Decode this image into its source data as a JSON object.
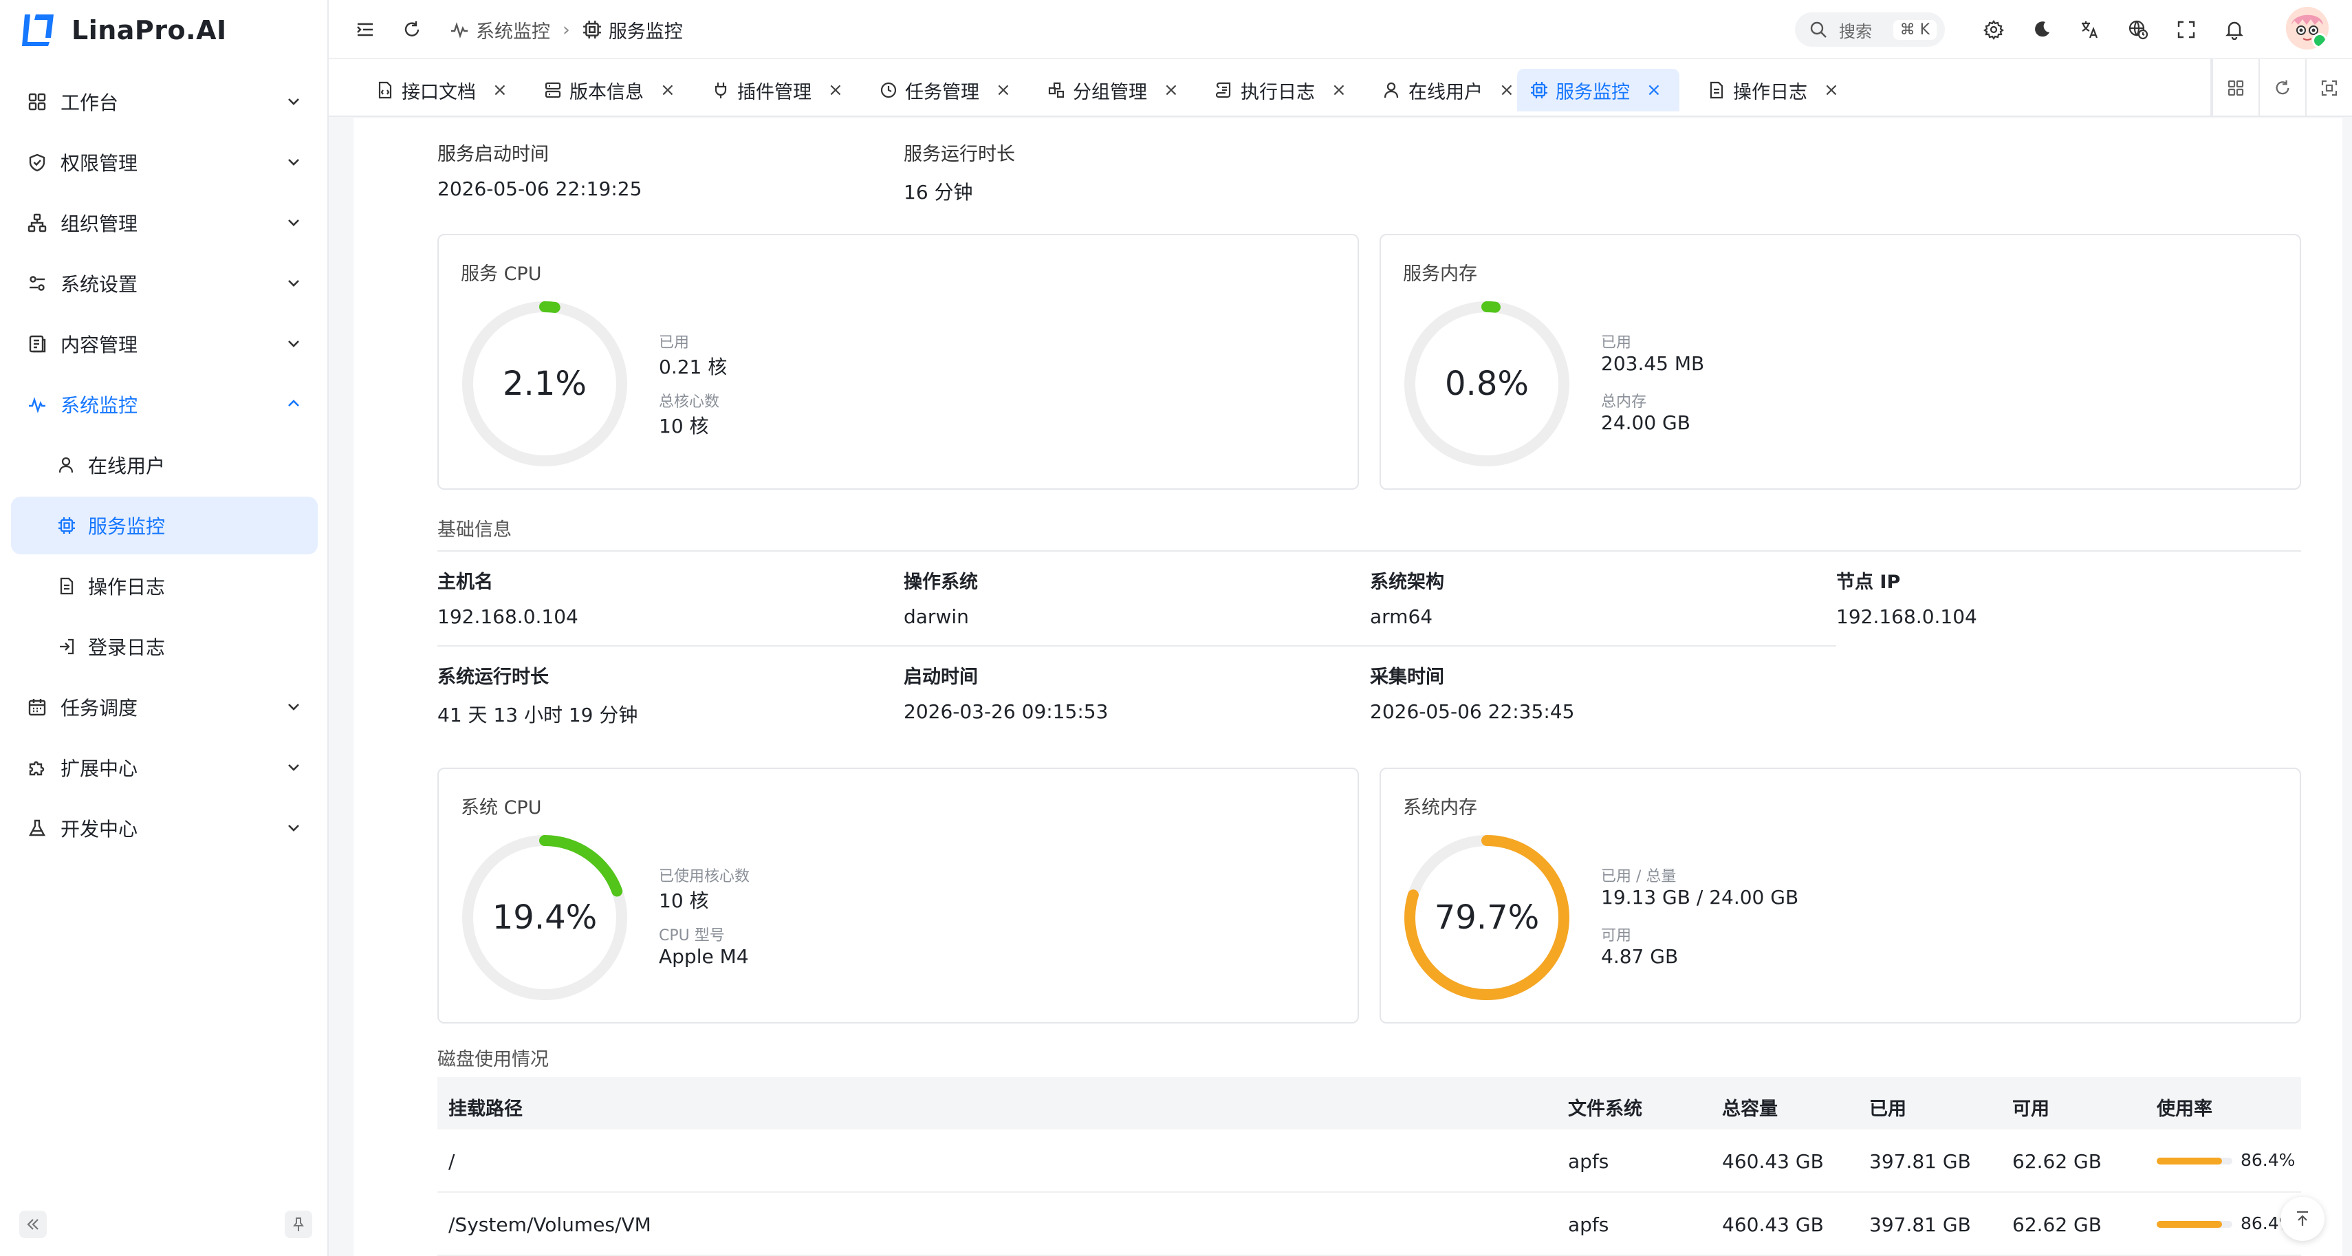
{
  "app": {
    "name": "LinaPro.AI"
  },
  "colors": {
    "accent": "#1677ff",
    "green": "#52c41a",
    "orange": "#f5a623",
    "track": "#ededed"
  },
  "sidebar": {
    "items": [
      {
        "label": "工作台",
        "icon": "dashboard-icon"
      },
      {
        "label": "权限管理",
        "icon": "shield-icon"
      },
      {
        "label": "组织管理",
        "icon": "org-tree-icon"
      },
      {
        "label": "系统设置",
        "icon": "settings-sliders-icon"
      },
      {
        "label": "内容管理",
        "icon": "document-icon"
      },
      {
        "label": "系统监控",
        "icon": "pulse-icon",
        "expanded": true
      }
    ],
    "subitems": [
      {
        "label": "在线用户",
        "icon": "user-icon"
      },
      {
        "label": "服务监控",
        "icon": "chip-icon",
        "active": true
      },
      {
        "label": "操作日志",
        "icon": "file-icon"
      },
      {
        "label": "登录日志",
        "icon": "login-icon"
      }
    ],
    "items_after": [
      {
        "label": "任务调度",
        "icon": "calendar-icon"
      },
      {
        "label": "扩展中心",
        "icon": "puzzle-icon"
      },
      {
        "label": "开发中心",
        "icon": "flask-icon"
      }
    ]
  },
  "header": {
    "breadcrumb": [
      "系统监控",
      "服务监控"
    ],
    "search_placeholder": "搜索",
    "search_shortcut": "⌘ K"
  },
  "tabs": [
    {
      "label": "接口文档",
      "icon": "doc-icon"
    },
    {
      "label": "版本信息",
      "icon": "server-icon"
    },
    {
      "label": "插件管理",
      "icon": "plug-icon"
    },
    {
      "label": "任务管理",
      "icon": "clock-icon"
    },
    {
      "label": "分组管理",
      "icon": "group-icon"
    },
    {
      "label": "执行日志",
      "icon": "scroll-icon"
    },
    {
      "label": "在线用户",
      "icon": "user-icon"
    },
    {
      "label": "服务监控",
      "icon": "chip-icon",
      "active": true
    },
    {
      "label": "操作日志",
      "icon": "file-icon"
    }
  ],
  "service": {
    "start_label": "服务启动时间",
    "start_value": "2026-05-06 22:19:25",
    "uptime_label": "服务运行时长",
    "uptime_value": "16 分钟"
  },
  "service_cpu": {
    "title": "服务 CPU",
    "percent_text": "2.1%",
    "percent": 2.1,
    "used_label": "已用",
    "used_value": "0.21 核",
    "total_label": "总核心数",
    "total_value": "10 核"
  },
  "service_mem": {
    "title": "服务内存",
    "percent_text": "0.8%",
    "percent": 0.8,
    "used_label": "已用",
    "used_value": "203.45 MB",
    "total_label": "总内存",
    "total_value": "24.00 GB"
  },
  "basic": {
    "title": "基础信息",
    "hostname_label": "主机名",
    "hostname_value": "192.168.0.104",
    "os_label": "操作系统",
    "os_value": "darwin",
    "arch_label": "系统架构",
    "arch_value": "arm64",
    "ip_label": "节点 IP",
    "ip_value": "192.168.0.104",
    "uptime_label": "系统运行时长",
    "uptime_value": "41 天 13 小时 19 分钟",
    "boot_label": "启动时间",
    "boot_value": "2026-03-26 09:15:53",
    "collect_label": "采集时间",
    "collect_value": "2026-05-06 22:35:45"
  },
  "sys_cpu": {
    "title": "系统 CPU",
    "percent_text": "19.4%",
    "percent": 19.4,
    "cores_label": "已使用核心数",
    "cores_value": "10 核",
    "model_label": "CPU 型号",
    "model_value": "Apple M4"
  },
  "sys_mem": {
    "title": "系统内存",
    "percent_text": "79.7%",
    "percent": 79.7,
    "used_label": "已用 / 总量",
    "used_value": "19.13 GB / 24.00 GB",
    "avail_label": "可用",
    "avail_value": "4.87 GB"
  },
  "disk": {
    "title": "磁盘使用情况",
    "columns": [
      "挂载路径",
      "文件系统",
      "总容量",
      "已用",
      "可用",
      "使用率"
    ],
    "rows": [
      {
        "path": "/",
        "fs": "apfs",
        "total": "460.43 GB",
        "used": "397.81 GB",
        "free": "62.62 GB",
        "rate_text": "86.4%",
        "rate": 86.4
      },
      {
        "path": "/System/Volumes/VM",
        "fs": "apfs",
        "total": "460.43 GB",
        "used": "397.81 GB",
        "free": "62.62 GB",
        "rate_text": "86.4%",
        "rate": 86.4
      }
    ]
  }
}
